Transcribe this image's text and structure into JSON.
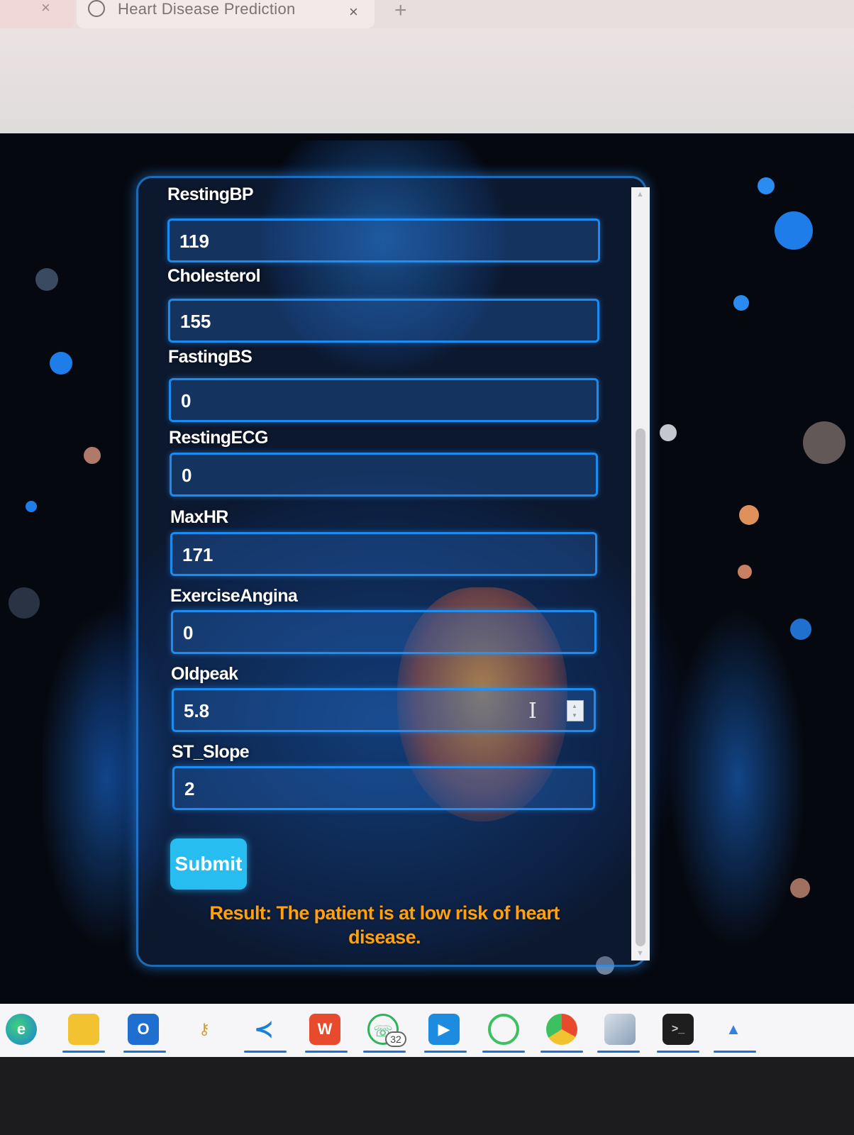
{
  "browser": {
    "tab_title": "Heart Disease Prediction",
    "close_symbol": "×",
    "new_tab_symbol": "+"
  },
  "form": {
    "fields": [
      {
        "label": "RestingBP",
        "value": "119"
      },
      {
        "label": "Cholesterol",
        "value": "155"
      },
      {
        "label": "FastingBS",
        "value": "0"
      },
      {
        "label": "RestingECG",
        "value": "0"
      },
      {
        "label": "MaxHR",
        "value": "171"
      },
      {
        "label": "ExerciseAngina",
        "value": "0"
      },
      {
        "label": "Oldpeak",
        "value": "5.8"
      },
      {
        "label": "ST_Slope",
        "value": "2"
      }
    ],
    "submit_label": "Submit",
    "result_text": "Result: The patient is at low risk of heart disease."
  },
  "taskbar": {
    "whatsapp_badge": "32",
    "icons": [
      "edge-icon",
      "file-explorer-icon",
      "outlook-icon",
      "vpn-key-icon",
      "vscode-icon",
      "wps-office-icon",
      "whatsapp-icon",
      "media-player-icon",
      "circle-app-icon",
      "chrome-profile-icon",
      "notes-app-icon",
      "terminal-icon",
      "photos-app-icon"
    ]
  },
  "colors": {
    "panel_border": "#2896ff",
    "submit_bg": "#27bdf0",
    "result_text": "#ffa10f",
    "label_text": "#ffffff"
  }
}
